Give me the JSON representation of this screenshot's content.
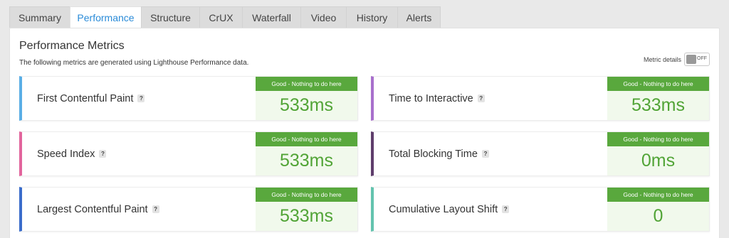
{
  "tabs": [
    {
      "label": "Summary",
      "active": false
    },
    {
      "label": "Performance",
      "active": true
    },
    {
      "label": "Structure",
      "active": false
    },
    {
      "label": "CrUX",
      "active": false
    },
    {
      "label": "Waterfall",
      "active": false
    },
    {
      "label": "Video",
      "active": false
    },
    {
      "label": "History",
      "active": false
    },
    {
      "label": "Alerts",
      "active": false
    }
  ],
  "panel": {
    "title": "Performance Metrics",
    "description": "The following metrics are generated using Lighthouse Performance data.",
    "toggle_label": "Metric details",
    "toggle_state": "OFF"
  },
  "help_glyph": "?",
  "metrics": [
    {
      "name": "First Contentful Paint",
      "status": "Good - Nothing to do here",
      "value": "533ms",
      "accent": "#5aaee6"
    },
    {
      "name": "Time to Interactive",
      "status": "Good - Nothing to do here",
      "value": "533ms",
      "accent": "#a86fcc"
    },
    {
      "name": "Speed Index",
      "status": "Good - Nothing to do here",
      "value": "533ms",
      "accent": "#e2659d"
    },
    {
      "name": "Total Blocking Time",
      "status": "Good - Nothing to do here",
      "value": "0ms",
      "accent": "#5e3d6b"
    },
    {
      "name": "Largest Contentful Paint",
      "status": "Good - Nothing to do here",
      "value": "533ms",
      "accent": "#3b6dcb"
    },
    {
      "name": "Cumulative Layout Shift",
      "status": "Good - Nothing to do here",
      "value": "0",
      "accent": "#63c3ae"
    }
  ],
  "colors": {
    "status_good": "#59a83d",
    "value_good": "#51a436",
    "active_tab": "#2a8bd8"
  }
}
